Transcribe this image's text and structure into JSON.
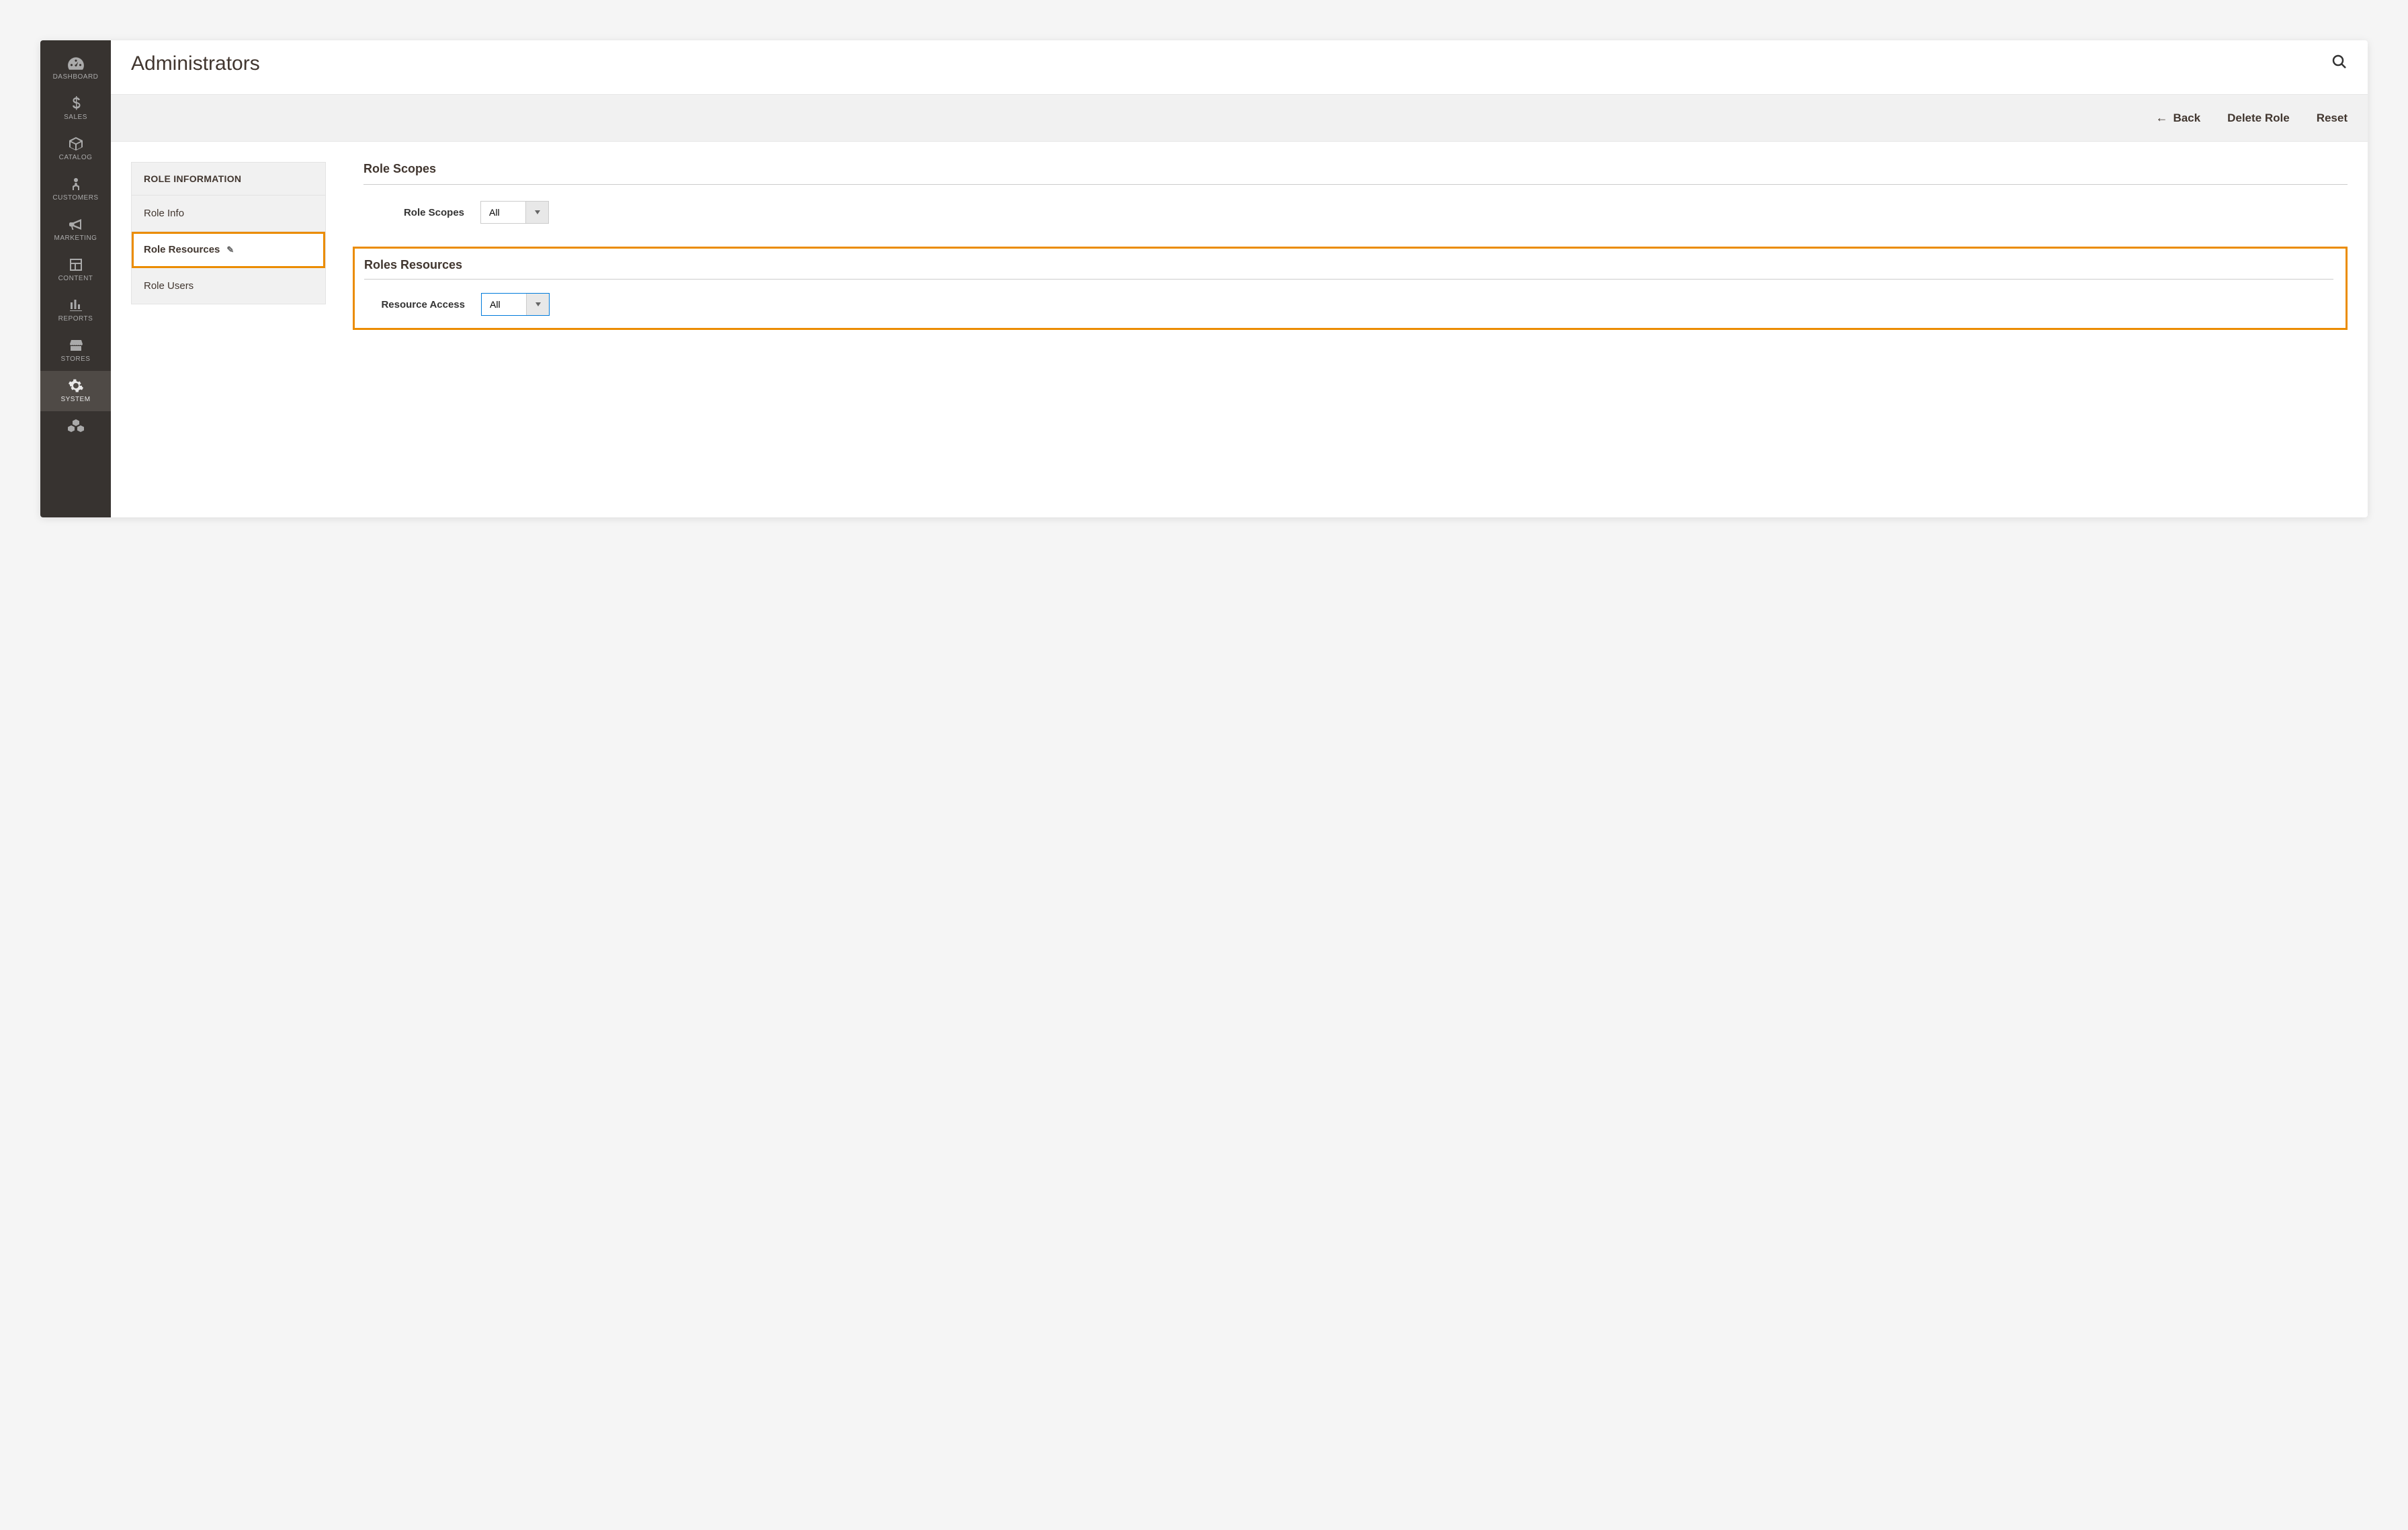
{
  "sidebar": {
    "items": [
      {
        "label": "DASHBOARD",
        "name": "sidebar-item-dashboard",
        "icon": "gauge"
      },
      {
        "label": "SALES",
        "name": "sidebar-item-sales",
        "icon": "dollar"
      },
      {
        "label": "CATALOG",
        "name": "sidebar-item-catalog",
        "icon": "box"
      },
      {
        "label": "CUSTOMERS",
        "name": "sidebar-item-customers",
        "icon": "person"
      },
      {
        "label": "MARKETING",
        "name": "sidebar-item-marketing",
        "icon": "megaphone"
      },
      {
        "label": "CONTENT",
        "name": "sidebar-item-content",
        "icon": "layout"
      },
      {
        "label": "REPORTS",
        "name": "sidebar-item-reports",
        "icon": "bars"
      },
      {
        "label": "STORES",
        "name": "sidebar-item-stores",
        "icon": "storefront"
      },
      {
        "label": "SYSTEM",
        "name": "sidebar-item-system",
        "icon": "gear",
        "active": true
      },
      {
        "label": "",
        "name": "sidebar-item-extensions",
        "icon": "blocks"
      }
    ]
  },
  "header": {
    "title": "Administrators"
  },
  "toolbar": {
    "back_label": "Back",
    "delete_label": "Delete Role",
    "reset_label": "Reset"
  },
  "tabs": {
    "header": "ROLE INFORMATION",
    "items": [
      {
        "label": "Role Info"
      },
      {
        "label": "Role Resources",
        "active": true,
        "highlighted": true
      },
      {
        "label": "Role Users"
      }
    ]
  },
  "sections": {
    "scopes": {
      "title": "Role Scopes",
      "field_label": "Role Scopes",
      "value": "All"
    },
    "resources": {
      "title": "Roles Resources",
      "field_label": "Resource Access",
      "value": "All"
    }
  }
}
